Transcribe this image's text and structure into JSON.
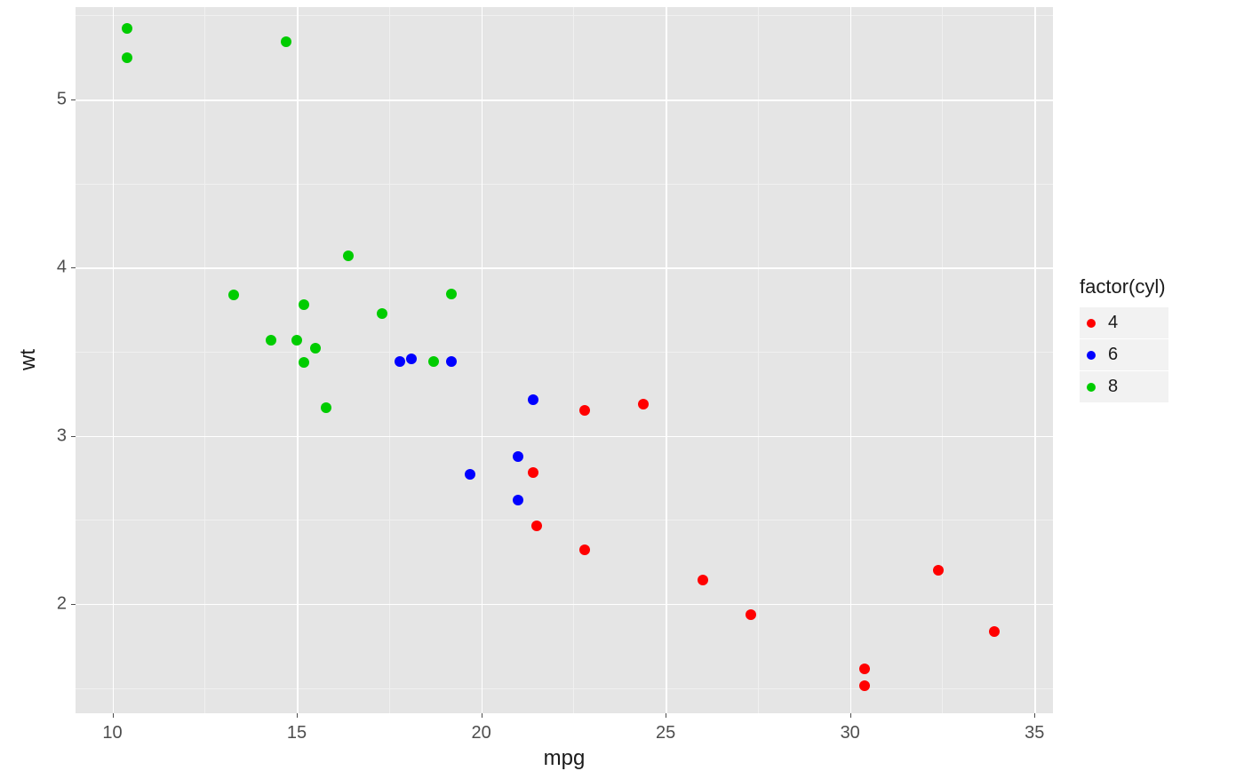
{
  "chart_data": {
    "type": "scatter",
    "xlabel": "mpg",
    "ylabel": "wt",
    "xlim": [
      9,
      35.5
    ],
    "ylim": [
      1.35,
      5.55
    ],
    "x_ticks": [
      10,
      15,
      20,
      25,
      30,
      35
    ],
    "y_ticks": [
      2,
      3,
      4,
      5
    ],
    "legend_title": "factor(cyl)",
    "legend_position": "right",
    "series": [
      {
        "name": "4",
        "color": "#F8766D",
        "points": [
          {
            "x": 22.8,
            "y": 2.32
          },
          {
            "x": 24.4,
            "y": 3.19
          },
          {
            "x": 22.8,
            "y": 3.15
          },
          {
            "x": 32.4,
            "y": 2.2
          },
          {
            "x": 30.4,
            "y": 1.615
          },
          {
            "x": 33.9,
            "y": 1.835
          },
          {
            "x": 21.5,
            "y": 2.465
          },
          {
            "x": 27.3,
            "y": 1.935
          },
          {
            "x": 26.0,
            "y": 2.14
          },
          {
            "x": 30.4,
            "y": 1.513
          },
          {
            "x": 21.4,
            "y": 2.78
          }
        ]
      },
      {
        "name": "6",
        "color": "#00BA38",
        "points": [
          {
            "x": 21.0,
            "y": 2.62
          },
          {
            "x": 21.0,
            "y": 2.875
          },
          {
            "x": 21.4,
            "y": 3.215
          },
          {
            "x": 18.1,
            "y": 3.46
          },
          {
            "x": 19.2,
            "y": 3.44
          },
          {
            "x": 17.8,
            "y": 3.44
          },
          {
            "x": 19.7,
            "y": 2.77
          }
        ]
      },
      {
        "name": "8",
        "color": "#619CFF",
        "points": [
          {
            "x": 18.7,
            "y": 3.44
          },
          {
            "x": 14.3,
            "y": 3.57
          },
          {
            "x": 16.4,
            "y": 4.07
          },
          {
            "x": 17.3,
            "y": 3.73
          },
          {
            "x": 15.2,
            "y": 3.78
          },
          {
            "x": 10.4,
            "y": 5.25
          },
          {
            "x": 10.4,
            "y": 5.424
          },
          {
            "x": 14.7,
            "y": 5.345
          },
          {
            "x": 15.5,
            "y": 3.52
          },
          {
            "x": 15.2,
            "y": 3.435
          },
          {
            "x": 13.3,
            "y": 3.84
          },
          {
            "x": 19.2,
            "y": 3.845
          },
          {
            "x": 15.8,
            "y": 3.17
          },
          {
            "x": 15.0,
            "y": 3.57
          }
        ]
      }
    ],
    "legend_colors": {
      "4": "#ff0000",
      "6": "#0000ff",
      "8": "#00cc00"
    }
  }
}
